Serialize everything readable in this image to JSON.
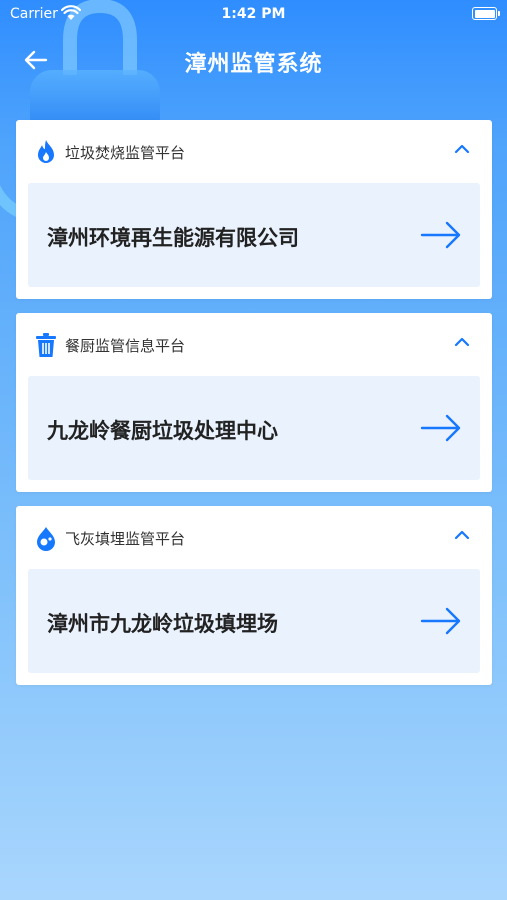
{
  "status_bar": {
    "carrier": "Carrier",
    "time": "1:42 PM",
    "battery_level": 1.0
  },
  "header": {
    "title": "漳州监管系统",
    "back_icon": "arrow-left-icon"
  },
  "colors": {
    "accent": "#1677ff",
    "card_row_bg": "#eaf2fd",
    "gradient_top": "#2f8dff",
    "gradient_bottom": "#a9d6fd"
  },
  "platforms": [
    {
      "name": "垃圾焚烧监管平台",
      "icon": "flame-icon",
      "facility": "漳州环境再生能源有限公司"
    },
    {
      "name": "餐厨监管信息平台",
      "icon": "trash-bin-icon",
      "facility": "九龙岭餐厨垃圾处理中心"
    },
    {
      "name": "飞灰填埋监管平台",
      "icon": "droplet-icon",
      "facility": "漳州市九龙岭垃圾填埋场"
    }
  ]
}
